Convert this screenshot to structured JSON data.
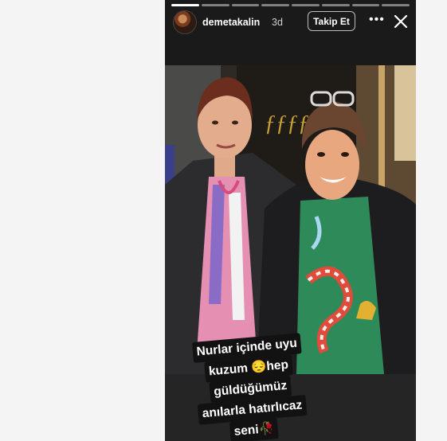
{
  "story": {
    "username": "demetakalin",
    "time": "3d",
    "follow_label": "Takip Et",
    "progress": {
      "total": 8,
      "completed": 1
    },
    "caption_lines": [
      "Nurlar içinde uyu",
      "kuzum 😔hep",
      "güldüğümüz",
      "anılarla hatırlıcaz",
      "seni🥀"
    ]
  },
  "icons": {
    "more": "more-horizontal-icon",
    "close": "close-icon"
  },
  "colors": {
    "background": "#1a1a1a",
    "text": "#ffffff",
    "side_panel": "#f4f4f4"
  }
}
